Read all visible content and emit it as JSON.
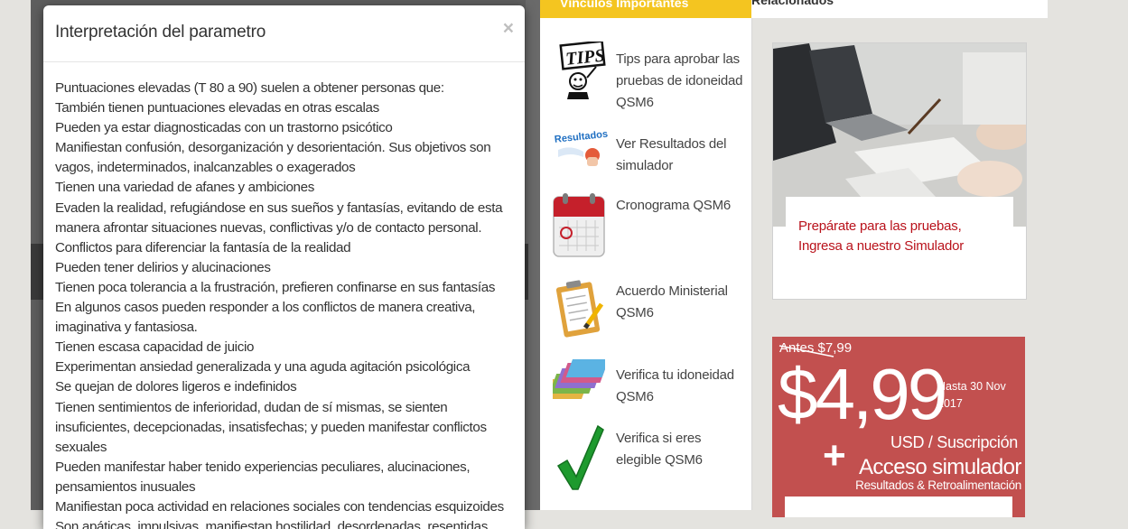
{
  "modal": {
    "title": "Interpretación del parametro",
    "close_label": "×",
    "lines": [
      "Puntuaciones elevadas (T 80 a 90) suelen a obtener personas que:",
      "También tienen puntuaciones elevadas en otras escalas",
      "Pueden ya estar diagnosticadas con un trastorno psicótico",
      "Manifiestan confusión, desorganización y desorientación. Sus objetivos son vagos, indeterminados, inalcanzables o exagerados",
      "Tienen una variedad de afanes y ambiciones",
      "Evaden la realidad, refugiándose en sus sueños y fantasías, evitando de esta manera afrontar situaciones nuevas, conflictivas y/o de contacto personal. Conflictos para diferenciar la fantasía de la realidad",
      "Pueden tener delirios y alucinaciones",
      "Tienen poca tolerancia a la frustración, prefieren confinarse en sus fantasías",
      "En algunos casos pueden responder a los conflictos de manera creativa, imaginativa y fantasiosa.",
      "Tienen escasa capacidad de juicio",
      "Experimentan ansiedad generalizada y una aguda agitación psicológica",
      "Se quejan de dolores ligeros e indefinidos",
      "Tienen sentimientos de inferioridad, dudan de sí mismas, se sienten insuficientes, decepcionadas, insatisfechas; y pueden manifestar conflictos sexuales",
      "Pueden manifestar haber tenido experiencias peculiares, alucinaciones, pensamientos inusuales",
      "Manifiestan poca actividad en relaciones sociales con tendencias esquizoides",
      "Son apáticas, impulsivas, manifiestan hostilidad, desordenadas, resentidas"
    ]
  },
  "middle": {
    "tab_label": "Vínculos Importantes",
    "links": [
      {
        "label": "Tips para aprobar las pruebas de idoneidad QSM6",
        "icon": "tips-icon"
      },
      {
        "label": "Ver Resultados del simulador",
        "icon": "resultados-icon"
      },
      {
        "label": "Cronograma QSM6",
        "icon": "calendar-icon"
      },
      {
        "label": "Acuerdo Ministerial QSM6",
        "icon": "clipboard-icon"
      },
      {
        "label": "Verifica tu idoneidad QSM6",
        "icon": "folders-icon"
      },
      {
        "label": "Verifica si eres elegible QSM6",
        "icon": "checkmark-icon"
      }
    ],
    "tips_icon_text": "TIPS",
    "resultados_icon_text": "Resultados"
  },
  "right": {
    "tab_label": "Relacionados",
    "sim_card_caption": "Prepárate para las pruebas, Ingresa a nuestro Simulador",
    "promo": {
      "old_price": "Antes $7,99",
      "price": "$4,99",
      "until": "Hasta 30 Nov 2017",
      "unit": "USD / Suscripción",
      "plus": "+",
      "access": "Acceso simulador",
      "results": "Resultados & Retroalimentación"
    }
  },
  "colors": {
    "accent_yellow": "#f4c520",
    "link_red": "#b9121b",
    "promo_red": "#c2504f"
  }
}
